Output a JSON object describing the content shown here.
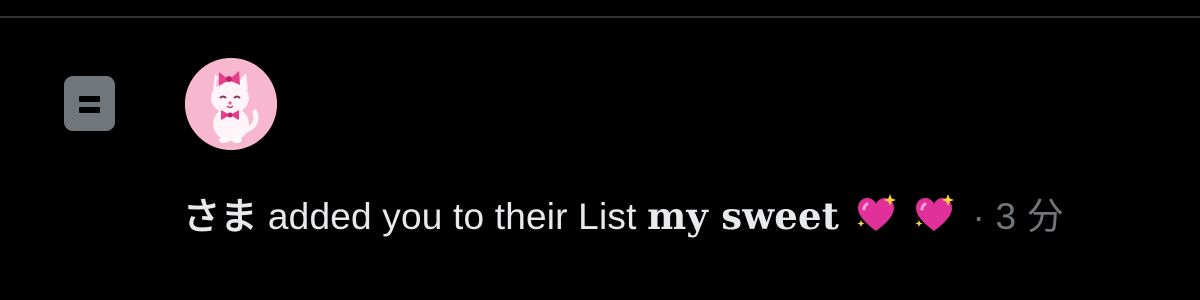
{
  "notification": {
    "type_icon": "list-icon",
    "avatar_icon": "pink-cat-avatar",
    "sender_name": "さま",
    "action_text": "added you to their List",
    "list_name": "my sweet",
    "list_emojis": [
      "sparkling-heart-emoji",
      "sparkling-heart-emoji"
    ],
    "separator": "·",
    "timestamp": "3 分"
  },
  "colors": {
    "background": "#000000",
    "divider": "#2f3336",
    "primary_text": "#e7e9ea",
    "secondary_text": "#71767b",
    "icon_gray": "#71767b",
    "avatar_pink": "#f6b7cf",
    "heart_pink": "#e0319a"
  }
}
